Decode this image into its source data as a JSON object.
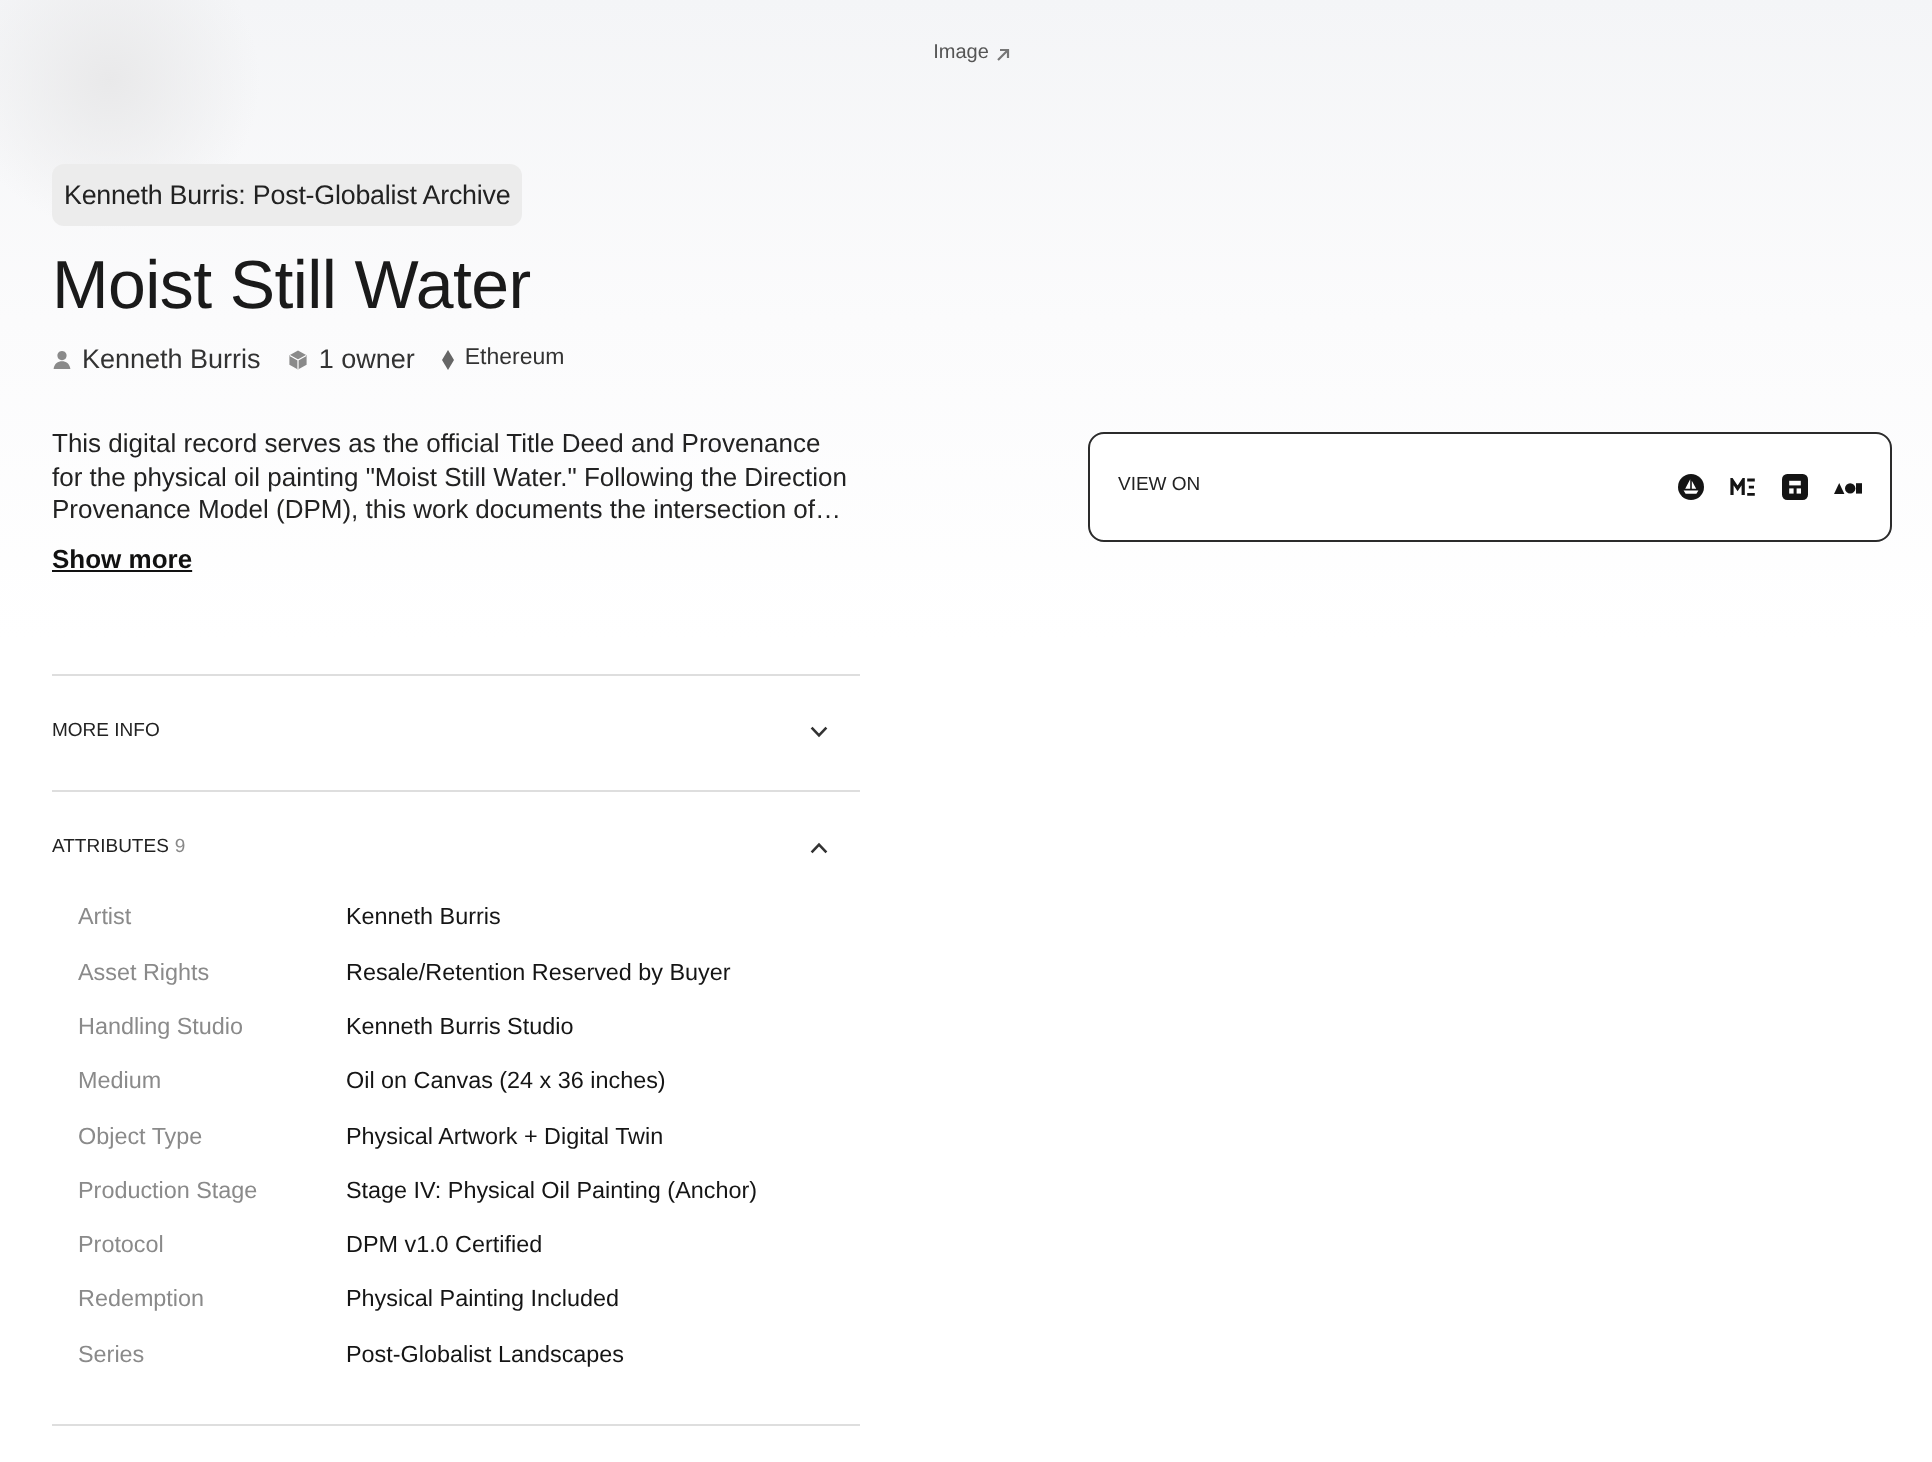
{
  "image_link": "Image",
  "collection_badge": "Kenneth Burris: Post-Globalist Archive",
  "title": "Moist Still Water",
  "meta": [
    {
      "kind": "creator",
      "label": "Kenneth Burris"
    },
    {
      "kind": "owners",
      "label": "1 owner"
    },
    {
      "kind": "chain",
      "label": "Ethereum"
    }
  ],
  "description": "This digital record serves as the official Title Deed and Provenance for the physical oil painting \"Moist Still Water.\" Following the Direction Provenance Model (DPM), this work documents the intersection of…",
  "show_more": "Show more",
  "sections": [
    {
      "title": "MORE INFO",
      "expanded": false
    },
    {
      "title": "ATTRIBUTES",
      "count": "9",
      "expanded": true,
      "rows": [
        {
          "label": "Artist",
          "value": "Kenneth Burris"
        },
        {
          "label": "Asset Rights",
          "value": "Resale/Retention Reserved by Buyer"
        },
        {
          "label": "Handling Studio",
          "value": "Kenneth Burris Studio"
        },
        {
          "label": "Medium",
          "value": "Oil on Canvas (24 x 36 inches)"
        },
        {
          "label": "Object Type",
          "value": "Physical Artwork + Digital Twin"
        },
        {
          "label": "Production Stage",
          "value": "Stage IV: Physical Oil Painting (Anchor)"
        },
        {
          "label": "Protocol",
          "value": "DPM v1.0 Certified"
        },
        {
          "label": "Redemption",
          "value": "Physical Painting Included"
        },
        {
          "label": "Series",
          "value": "Post-Globalist Landscapes"
        }
      ]
    }
  ],
  "view_on": {
    "label": "VIEW ON"
  }
}
